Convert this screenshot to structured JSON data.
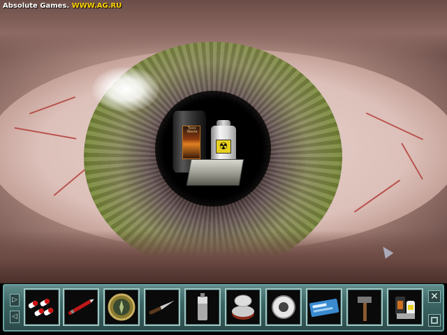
{
  "watermark": {
    "brand": "Absolute Games.",
    "url": "WWW.AG.RU"
  },
  "scene": {
    "barrel_label": "Toxic Waste"
  },
  "inventory": {
    "items": [
      {
        "name": "capsules",
        "icon": "pills-icon"
      },
      {
        "name": "red-pen",
        "icon": "pen-icon"
      },
      {
        "name": "compass",
        "icon": "compass-icon"
      },
      {
        "name": "knife",
        "icon": "knife-icon"
      },
      {
        "name": "lighter",
        "icon": "lighter-icon"
      },
      {
        "name": "tin-can",
        "icon": "can-icon"
      },
      {
        "name": "tape-roll",
        "icon": "tape-icon"
      },
      {
        "name": "id-card",
        "icon": "card-icon"
      },
      {
        "name": "hammer",
        "icon": "hammer-icon"
      },
      {
        "name": "barrel-set",
        "icon": "barrel-set-icon"
      }
    ]
  },
  "colors": {
    "bar": "#3c6564",
    "bar_border": "#6aa3a0",
    "watermark_url": "#ffd400"
  }
}
